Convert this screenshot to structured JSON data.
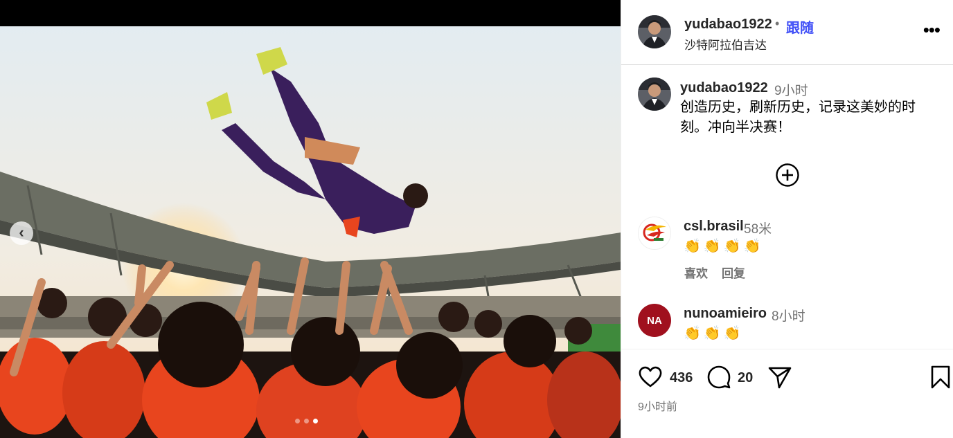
{
  "post": {
    "username": "yudabao1922",
    "separator": "•",
    "follow_label": "跟随",
    "location": "沙特阿拉伯吉达",
    "more_label": "•••"
  },
  "caption": {
    "username": "yudabao1922",
    "time": "9小时",
    "text": "创造历史，刷新历史，记录这美妙的时刻。冲向半决赛！"
  },
  "comments": [
    {
      "username": "csl.brasil",
      "time": "58米",
      "text": "👏👏👏👏",
      "like_label": "喜欢",
      "reply_label": "回复"
    },
    {
      "username": "nunoamieiro",
      "time": "8小时",
      "text": "👏👏👏",
      "avatar_initials": "NA"
    }
  ],
  "actions": {
    "likes": "436",
    "comments": "20",
    "posted_time": "9小时前"
  },
  "carousel": {
    "prev_label": "‹",
    "total_slides": 3,
    "active_slide": 3
  },
  "colors": {
    "follow_blue": "#4150f7",
    "jersey_orange": "#e8451e",
    "keeper_purple": "#3a1f5c",
    "avatar_red": "#a0101e"
  }
}
